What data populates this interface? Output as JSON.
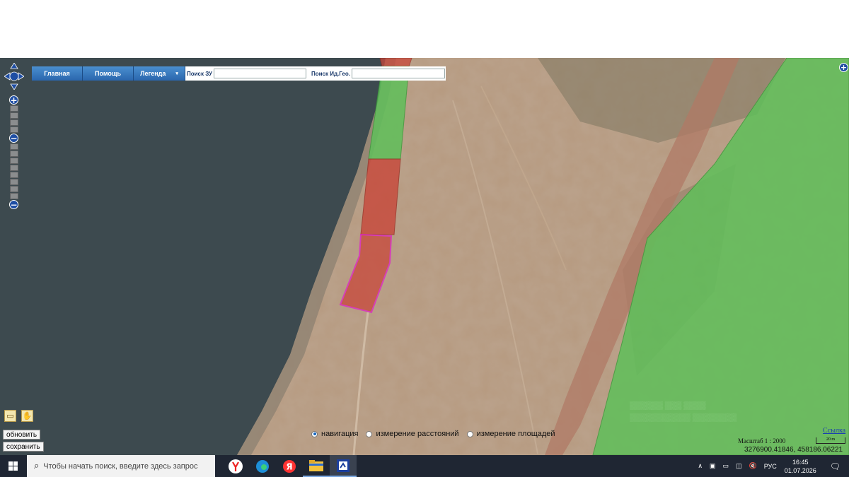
{
  "toolbar": {
    "home_label": "Главная",
    "help_label": "Помощь",
    "legend_label": "Легенда",
    "legend_caret": "▾"
  },
  "search": {
    "parcel_label": "Поиск ЗУ",
    "parcel_value": "",
    "geo_label": "Поиск Ид.Гео.",
    "geo_value": ""
  },
  "zoom": {
    "plus": "+",
    "minus": "−"
  },
  "controls": {
    "refresh_label": "обновить",
    "save_label": "сохранить"
  },
  "modes": [
    {
      "label": "навигация",
      "selected": true
    },
    {
      "label": "измерение расстояний",
      "selected": false
    },
    {
      "label": "измерение площадей",
      "selected": false
    }
  ],
  "map_info": {
    "link_label": "Ссылка",
    "scale_label": "Масштаб 1 : 2000",
    "scale_bar_label": "20 m",
    "coordinates": "3276900.41846, 458186.06221"
  },
  "taskbar": {
    "search_placeholder": "Чтобы начать поиск, введите здесь запрос",
    "language": "РУС",
    "time": "16:45",
    "date": "01.07.2026"
  },
  "colors": {
    "water": "#3d4a4f",
    "sand": "#b69a80",
    "parcel_red": "#c8473a",
    "parcel_green": "#5fc05a",
    "selection_magenta": "#e020c8",
    "toolbar_blue": "#2a66ad"
  },
  "icons": [
    "pan-control-icon",
    "zoom-in-icon",
    "zoom-out-icon",
    "select-tool-icon",
    "hand-tool-icon",
    "windows-logo-icon",
    "search-icon",
    "yandex-browser-icon",
    "edge-icon",
    "yandex-icon",
    "folder-icon",
    "app-icon",
    "chevron-up-icon",
    "notification-icon"
  ]
}
